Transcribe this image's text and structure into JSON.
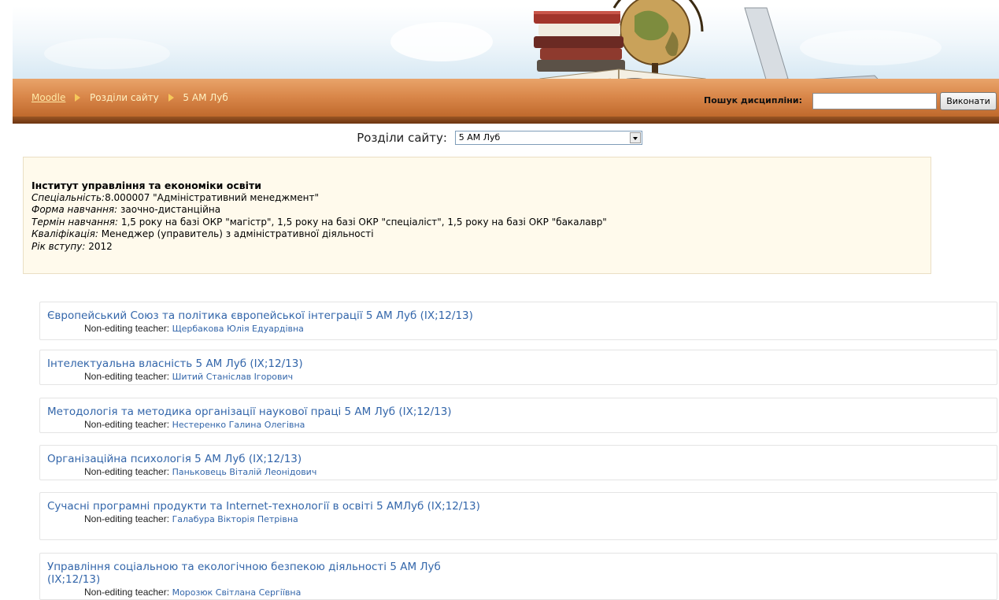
{
  "header": {
    "breadcrumb": {
      "home": "Moodle",
      "section": "Розділи сайту",
      "current": "5 АМ Луб"
    },
    "search": {
      "label": "Пошук дисципліни:",
      "value": "",
      "button": "Виконати"
    }
  },
  "sections": {
    "label": "Розділи сайту:",
    "selected": "5 АМ Луб"
  },
  "info": {
    "institute": "Інститут управління та економіки освіти",
    "speciality_label": "Спеціальність:",
    "speciality_value": "8.000007 \"Адміністративний менеджмент\"",
    "form_label": "Форма навчання:",
    "form_value": " заочно-дистанційна",
    "term_label": "Термін навчання:",
    "term_value": " 1,5 року на базі ОКР \"магістр\", 1,5 року на базі ОКР \"спеціаліст\", 1,5 року на базі ОКР \"бакалавр\"",
    "qual_label": "Кваліфікація:",
    "qual_value": " Менеджер (управитель) з адміністративної діяльності",
    "year_label": "Рік вступу:",
    "year_value": " 2012"
  },
  "courses": [
    {
      "name": "Європейський Союз та політика європейської інтеграції 5 АМ Луб (IX;12/13)",
      "role": "Non-editing teacher:",
      "teacher": "Щербакова Юлія Едуардівна"
    },
    {
      "name": "Інтелектуальна власність 5 АМ Луб (IX;12/13)",
      "role": "Non-editing teacher:",
      "teacher": "Шитий Станіслав Ігорович"
    },
    {
      "name": "Методологія та методика організації наукової праці 5 АМ Луб (IX;12/13)",
      "role": "Non-editing teacher:",
      "teacher": "Нестеренко Галина Олегівна"
    },
    {
      "name": "Організаційна психологія 5 АМ Луб (IX;12/13)",
      "role": "Non-editing teacher:",
      "teacher": "Паньковець Віталій Леонідович"
    },
    {
      "name": "Сучасні програмні продукти та Internet-технології в освіті 5 АМЛуб (IX;12/13)",
      "role": "Non-editing teacher:",
      "teacher": "Галабура Вікторія Петрівна"
    },
    {
      "name": "Управління соціальною та екологічною безпекою діяльності 5 АМ Луб (IX;12/13)",
      "role": "Non-editing teacher:",
      "teacher": "Морозюк Світлана Сергіївна"
    }
  ]
}
